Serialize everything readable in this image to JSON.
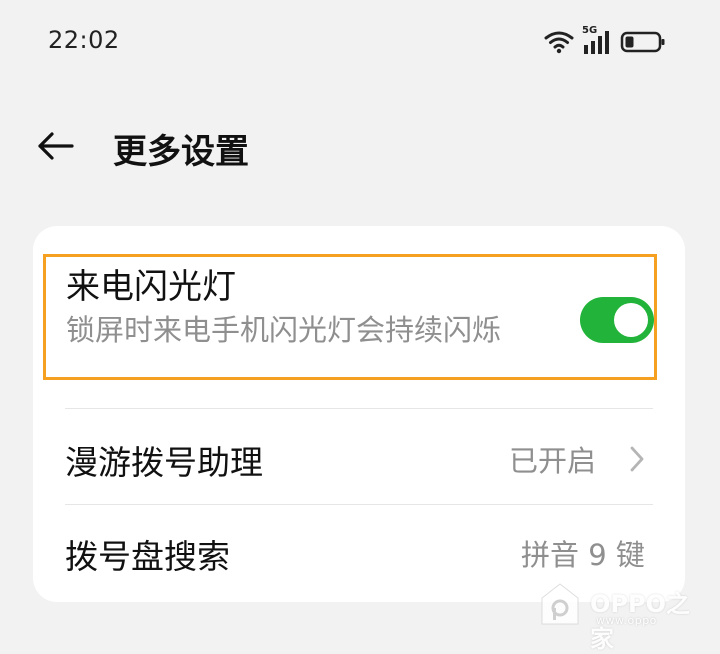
{
  "status_bar": {
    "time": "22:02",
    "network_label": "5G",
    "icons": [
      "wifi-icon",
      "cellular-5g-icon",
      "battery-icon"
    ]
  },
  "header": {
    "back_icon": "arrow-left-icon",
    "title": "更多设置"
  },
  "settings": {
    "call_flash": {
      "title": "来电闪光灯",
      "description": "锁屏时来电手机闪光灯会持续闪烁",
      "enabled": true
    },
    "roaming_assistant": {
      "label": "漫游拨号助理",
      "value": "已开启"
    },
    "dialpad_search": {
      "label": "拨号盘搜索",
      "value": "拼音 9 键"
    }
  },
  "watermark": {
    "brand": "OPPO之家",
    "url": "www.oppo"
  },
  "colors": {
    "background": "#f2f2f2",
    "card": "#ffffff",
    "toggle_on": "#22b33a",
    "highlight_border": "#f5a020",
    "secondary_text": "#8f8f8f"
  }
}
